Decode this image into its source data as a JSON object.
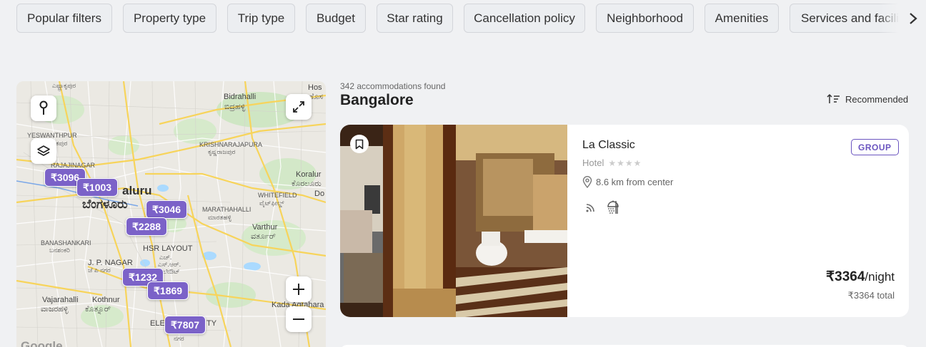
{
  "filters": [
    {
      "label": "Popular filters"
    },
    {
      "label": "Property type"
    },
    {
      "label": "Trip type"
    },
    {
      "label": "Budget"
    },
    {
      "label": "Star rating"
    },
    {
      "label": "Cancellation policy"
    },
    {
      "label": "Neighborhood"
    },
    {
      "label": "Amenities"
    },
    {
      "label": "Services and faciliti"
    }
  ],
  "filters_next_icon": "chevron-right-icon",
  "map": {
    "labels": {
      "top": "ಎಷ್ಟ್ರಾಕೃಪುರ",
      "bidrahalli": "Bidrahalli",
      "bidrahalli_kn": "ಬಿದ್ರಹಳ್ಳಿ",
      "hos": "Hos",
      "hos_kn": "ಹೊಸ",
      "yeswanthpur": "YESWANTHPUR",
      "yeswanthpur_kn": "ಶ್ವಂತಪುರ",
      "krishnarajapura": "KRISHNARAJAPURA",
      "krishnarajapura_kn": "ಕೃಷ್ಣರಾಜಪುರ",
      "rajajinagar": "RAJAJINAGAR",
      "bengaluru": "aluru",
      "bengaluru_kn": "ಬೆಂಗಳೂರು",
      "koralur": "Koralur",
      "koralur_kn": "ಕೊರಲೂರು",
      "whitefield": "WHITEFIELD",
      "whitefield_kn": "ವೈಟ್‌ಫೀಲ್ಡ್",
      "do": "Do",
      "marathahalli": "MARATHAHALLI",
      "marathahalli_kn": "ಮಾರತಹಳ್ಳಿ",
      "varthur": "Varthur",
      "varthur_kn": "ವರ್ತೂರ್",
      "banashankari": "BANASHANKARI",
      "banashankari_kn": "ಬನಶಂಕರಿ",
      "hsr": "HSR LAYOUT",
      "hsr_kn1": "ಎಚ್.",
      "hsr_kn2": "ಎಸ್.ಆರ್.",
      "hsr_kn3": "ಲೇಔಟ್",
      "jpnagar": "J. P. NAGAR",
      "jpnagar_kn": "ಜೆ ಪಿ ನಗರ",
      "vajarahalli": "Vajarahalli",
      "vajarahalli_kn": "ವಾಜರಹಳ್ಳಿ",
      "kothnur": "Kothnur",
      "kothnur_kn": "ಕೊತ್ನೂರ್",
      "kada": "Kada Agrahara",
      "ele": "ELE",
      "ty": "TY",
      "nagar_kn": "ನಗರ"
    },
    "pins": [
      {
        "price": "₹3096"
      },
      {
        "price": "₹1003"
      },
      {
        "price": "₹3046"
      },
      {
        "price": "₹2288"
      },
      {
        "price": "₹1232"
      },
      {
        "price": "₹1869"
      },
      {
        "price": "₹7807"
      }
    ],
    "google": "Google"
  },
  "results": {
    "count_text": "342 accommodations found",
    "city": "Bangalore",
    "sort_label": "Recommended"
  },
  "listing": {
    "name": "La Classic",
    "type": "Hotel",
    "stars": "★★★★",
    "distance": "8.6 km from center",
    "badge": "GROUP",
    "price": "₹3364",
    "price_unit": "/night",
    "total": "₹3364 total",
    "amenity_icons": [
      "wifi-icon",
      "shower-icon"
    ]
  },
  "colors": {
    "accent": "#7b62c8",
    "badge": "#6b55c0"
  }
}
